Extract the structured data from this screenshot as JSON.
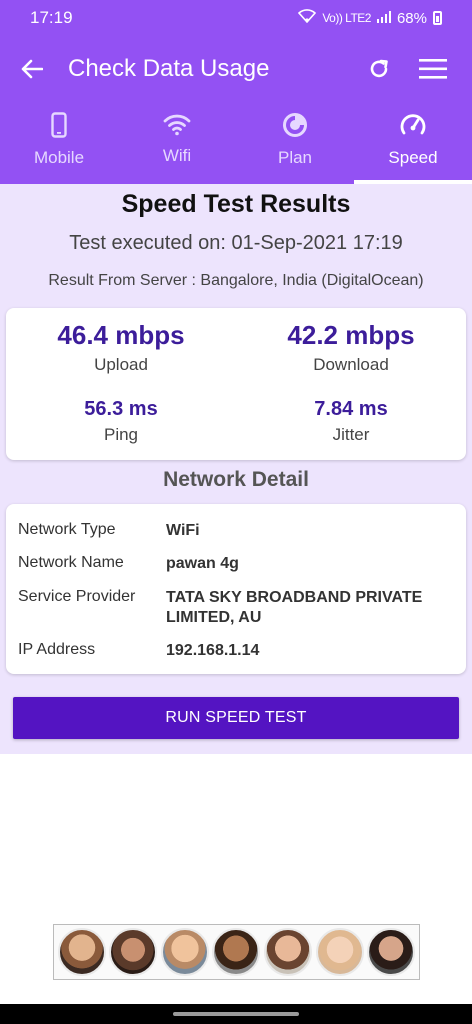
{
  "status_bar": {
    "time": "17:19",
    "network": "Vo)) LTE2",
    "battery": "68%"
  },
  "app_bar": {
    "title": "Check Data Usage"
  },
  "tabs": [
    {
      "label": "Mobile",
      "icon": "phone-icon",
      "active": false
    },
    {
      "label": "Wifi",
      "icon": "wifi-icon",
      "active": false
    },
    {
      "label": "Plan",
      "icon": "plan-icon",
      "active": false
    },
    {
      "label": "Speed",
      "icon": "speedometer-icon",
      "active": true
    }
  ],
  "results": {
    "title": "Speed Test Results",
    "executed": "Test executed on: 01-Sep-2021 17:19",
    "server": "Result From Server : Bangalore, India (DigitalOcean)",
    "upload": {
      "value": "46.4 mbps",
      "label": "Upload"
    },
    "download": {
      "value": "42.2 mbps",
      "label": "Download"
    },
    "ping": {
      "value": "56.3 ms",
      "label": "Ping"
    },
    "jitter": {
      "value": "7.84 ms",
      "label": "Jitter"
    }
  },
  "network": {
    "title": "Network Detail",
    "rows": [
      {
        "key": "Network Type",
        "value": "WiFi"
      },
      {
        "key": "Network Name",
        "value": "pawan 4g"
      },
      {
        "key": "Service Provider",
        "value": "TATA SKY BROADBAND PRIVATE LIMITED, AU"
      },
      {
        "key": "IP Address",
        "value": "192.168.1.14"
      }
    ]
  },
  "run_button": {
    "label": "RUN SPEED TEST"
  },
  "colors": {
    "primary": "#9351f3",
    "accent": "#5414c2",
    "value_text": "#3c1d9a",
    "background": "#ede4fd"
  }
}
